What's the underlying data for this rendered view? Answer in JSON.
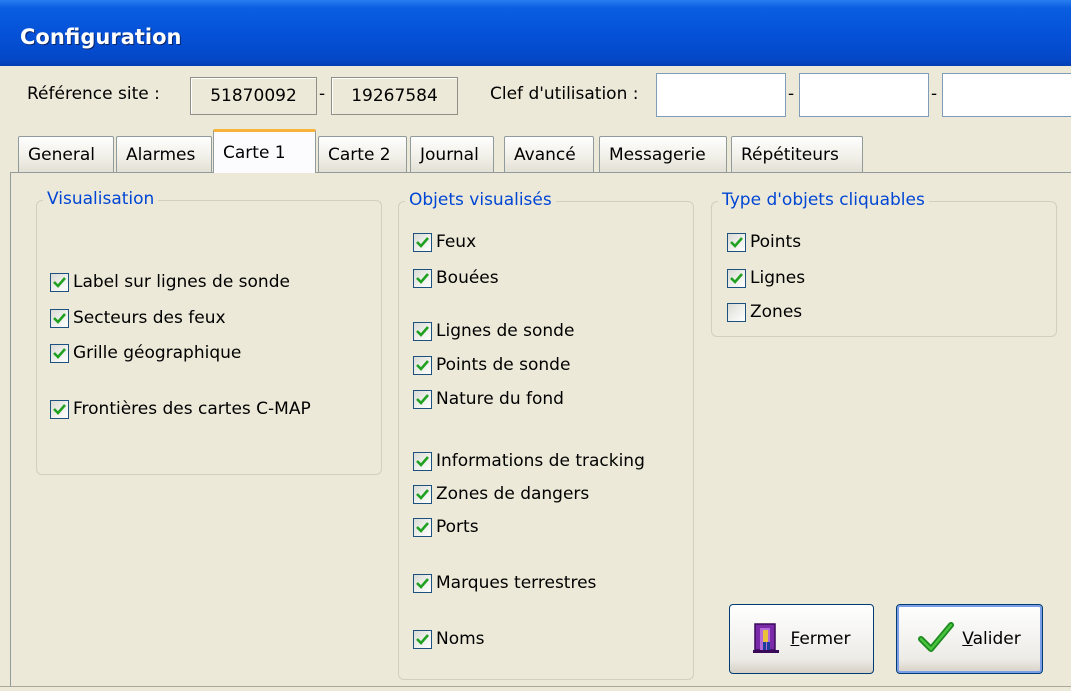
{
  "window": {
    "title": "Configuration"
  },
  "header": {
    "site_label": "Référence site :",
    "site_value_1": "51870092",
    "site_value_2": "19267584",
    "separator": "-",
    "key_label": "Clef d'utilisation :",
    "key_1": "",
    "key_2": "",
    "key_3": ""
  },
  "tabs": [
    "General",
    "Alarmes",
    "Carte 1",
    "Carte 2",
    "Journal",
    "Avancé",
    "Messagerie",
    "Répétiteurs"
  ],
  "active_tab": "Carte 1",
  "visualisation": {
    "title": "Visualisation",
    "items": [
      {
        "label": "Label sur lignes de sonde",
        "checked": true
      },
      {
        "label": "Secteurs des feux",
        "checked": true
      },
      {
        "label": "Grille géographique",
        "checked": true
      },
      {
        "label": "Frontières des cartes C-MAP",
        "checked": true
      }
    ]
  },
  "objets": {
    "title": "Objets visualisés",
    "items": [
      {
        "label": "Feux",
        "checked": true
      },
      {
        "label": "Bouées",
        "checked": true
      },
      {
        "label": "Lignes de sonde",
        "checked": true
      },
      {
        "label": "Points de sonde",
        "checked": true
      },
      {
        "label": "Nature du fond",
        "checked": true
      },
      {
        "label": "Informations de tracking",
        "checked": true
      },
      {
        "label": "Zones de dangers",
        "checked": true
      },
      {
        "label": "Ports",
        "checked": true
      },
      {
        "label": "Marques terrestres",
        "checked": true
      },
      {
        "label": "Noms",
        "checked": true
      }
    ]
  },
  "cliquables": {
    "title": "Type d'objets cliquables",
    "items": [
      {
        "label": "Points",
        "checked": true
      },
      {
        "label": "Lignes",
        "checked": true
      },
      {
        "label": "Zones",
        "checked": false
      }
    ]
  },
  "buttons": {
    "close_mnemonic": "F",
    "close_rest": "ermer",
    "ok_mnemonic": "V",
    "ok_rest": "alider"
  },
  "colors": {
    "titlebar": "#0552d8",
    "group_title": "#0046d5",
    "check": "#21a121",
    "tab_highlight": "#f8b33a"
  }
}
